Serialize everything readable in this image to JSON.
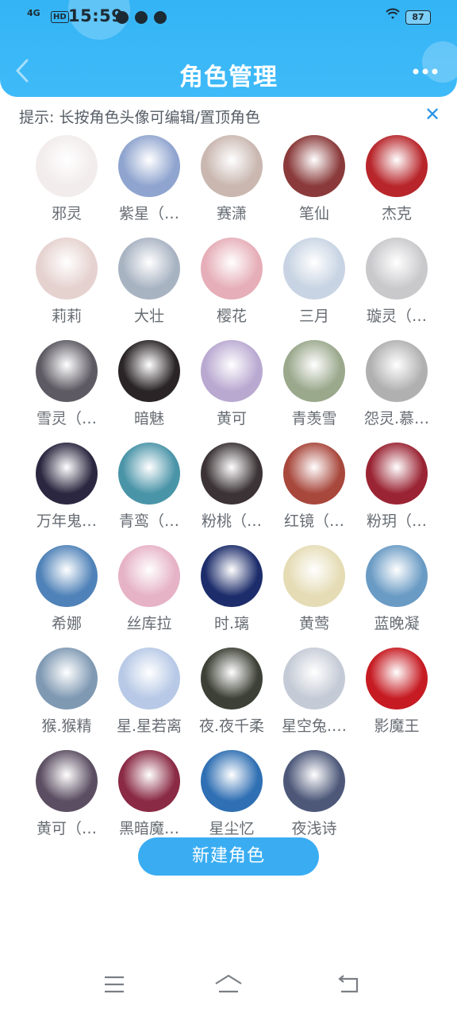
{
  "status_bar": {
    "signal": "4G",
    "hd": "HD",
    "time": "15:59",
    "battery": "87"
  },
  "header": {
    "title": "角色管理",
    "back_icon": "chevron-left-icon",
    "more_icon": "more-dots-icon",
    "color": "#3fbaf8"
  },
  "hint": {
    "text": "提示: 长按角色头像可编辑/置顶角色",
    "close_icon": "close-icon"
  },
  "roles": [
    {
      "name": "邪灵",
      "avatar_color": "#f2ecec"
    },
    {
      "name": "紫星（…",
      "avatar_color": "#8fa4cf"
    },
    {
      "name": "赛潇",
      "avatar_color": "#c9b7b0"
    },
    {
      "name": "笔仙",
      "avatar_color": "#8a3a3a"
    },
    {
      "name": "杰克",
      "avatar_color": "#b8262b"
    },
    {
      "name": "莉莉",
      "avatar_color": "#e5d2cf"
    },
    {
      "name": "大壮",
      "avatar_color": "#a8b3c2"
    },
    {
      "name": "樱花",
      "avatar_color": "#e6aeb8"
    },
    {
      "name": "三月",
      "avatar_color": "#c8d4e3"
    },
    {
      "name": "璇灵（…",
      "avatar_color": "#c9c9cc"
    },
    {
      "name": "雪灵（…",
      "avatar_color": "#5d5a63"
    },
    {
      "name": "暗魅",
      "avatar_color": "#2a2426"
    },
    {
      "name": "黄可",
      "avatar_color": "#b9a9d1"
    },
    {
      "name": "青羡雪",
      "avatar_color": "#9aa88c"
    },
    {
      "name": "怨灵.慕…",
      "avatar_color": "#b0b0b0"
    },
    {
      "name": "万年鬼…",
      "avatar_color": "#2c2740"
    },
    {
      "name": "青鸾（…",
      "avatar_color": "#4a94a8"
    },
    {
      "name": "粉桃（…",
      "avatar_color": "#3b3335"
    },
    {
      "name": "红镜（…",
      "avatar_color": "#a8473c"
    },
    {
      "name": "粉玥（…",
      "avatar_color": "#9a2433"
    },
    {
      "name": "希娜",
      "avatar_color": "#4f82b8"
    },
    {
      "name": "丝库拉",
      "avatar_color": "#e6b2c6"
    },
    {
      "name": "时.璃",
      "avatar_color": "#1d2d6b"
    },
    {
      "name": "黄莺",
      "avatar_color": "#e5dcb5"
    },
    {
      "name": "蓝晚凝",
      "avatar_color": "#6a9bc4"
    },
    {
      "name": "猴.猴精",
      "avatar_color": "#7f99b3"
    },
    {
      "name": "星.星若离",
      "avatar_color": "#b7c9e6"
    },
    {
      "name": "夜.夜千柔",
      "avatar_color": "#3d4036"
    },
    {
      "name": "星空兔.…",
      "avatar_color": "#c5cbd6"
    },
    {
      "name": "影魔王",
      "avatar_color": "#c61b22"
    },
    {
      "name": "黄可（…",
      "avatar_color": "#5b4e62"
    },
    {
      "name": "黑暗魔…",
      "avatar_color": "#8a2a44"
    },
    {
      "name": "星尘忆",
      "avatar_color": "#2f6fb3"
    },
    {
      "name": "夜浅诗",
      "avatar_color": "#4d5879"
    }
  ],
  "new_button": {
    "label": "新建角色",
    "color": "#3aadf2"
  },
  "navbar": {
    "menu_icon": "menu-icon",
    "home_icon": "home-icon",
    "back_icon": "back-icon"
  }
}
